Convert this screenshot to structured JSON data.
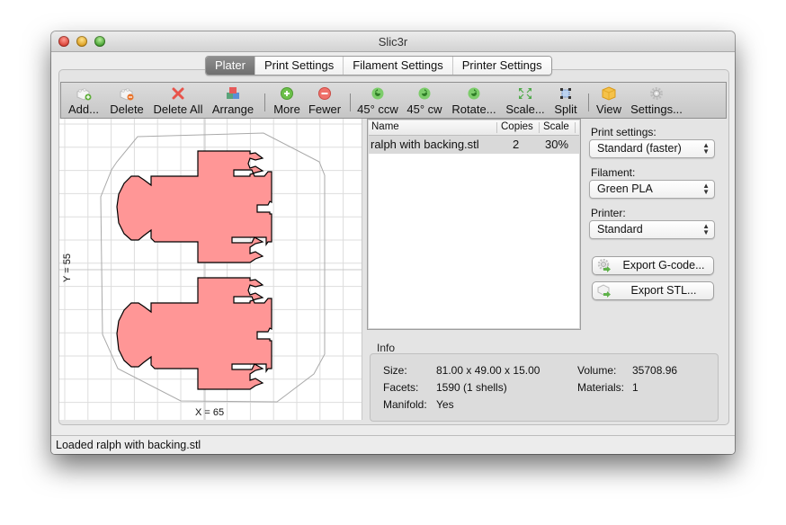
{
  "window": {
    "title": "Slic3r"
  },
  "tabs": [
    {
      "label": "Plater",
      "active": true
    },
    {
      "label": "Print Settings",
      "active": false
    },
    {
      "label": "Filament Settings",
      "active": false
    },
    {
      "label": "Printer Settings",
      "active": false
    }
  ],
  "toolbar": {
    "items": [
      {
        "label": "Add...",
        "icon": "add-object-icon"
      },
      {
        "label": "Delete",
        "icon": "delete-object-icon"
      },
      {
        "label": "Delete All",
        "icon": "delete-all-icon"
      },
      {
        "label": "Arrange",
        "icon": "arrange-icon"
      },
      {
        "label": "More",
        "icon": "plus-circle-icon"
      },
      {
        "label": "Fewer",
        "icon": "minus-circle-icon"
      },
      {
        "label": "45° ccw",
        "icon": "rotate-ccw-icon"
      },
      {
        "label": "45° cw",
        "icon": "rotate-cw-icon"
      },
      {
        "label": "Rotate...",
        "icon": "rotate-icon"
      },
      {
        "label": "Scale...",
        "icon": "scale-icon"
      },
      {
        "label": "Split",
        "icon": "split-icon"
      },
      {
        "label": "View",
        "icon": "view-cube-icon"
      },
      {
        "label": "Settings...",
        "icon": "gear-icon"
      }
    ]
  },
  "plater": {
    "x_label": "X = 65",
    "y_label": "Y = 55",
    "colors": {
      "object_fill": "#ff9696",
      "object_stroke": "#000000",
      "grid": "#dddddd",
      "hull": "#aaaaaa"
    }
  },
  "object_list": {
    "columns": [
      "Name",
      "Copies",
      "Scale"
    ],
    "rows": [
      {
        "name": "ralph with backing.stl",
        "copies": "2",
        "scale": "30%"
      }
    ]
  },
  "side": {
    "print_settings_label": "Print settings:",
    "print_settings_value": "Standard (faster)",
    "filament_label": "Filament:",
    "filament_value": "Green PLA",
    "printer_label": "Printer:",
    "printer_value": "Standard",
    "export_gcode": "Export G-code...",
    "export_stl": "Export STL..."
  },
  "info": {
    "title": "Info",
    "size_label": "Size:",
    "size_value": "81.00 x 49.00 x 15.00",
    "volume_label": "Volume:",
    "volume_value": "35708.96",
    "facets_label": "Facets:",
    "facets_value": "1590 (1 shells)",
    "materials_label": "Materials:",
    "materials_value": "1",
    "manifold_label": "Manifold:",
    "manifold_value": "Yes"
  },
  "status": {
    "text": "Loaded ralph with backing.stl"
  }
}
